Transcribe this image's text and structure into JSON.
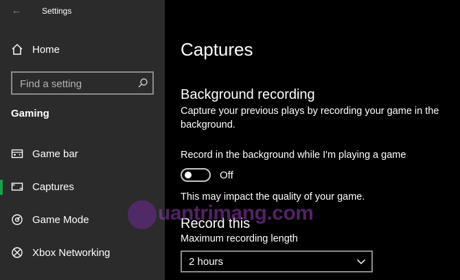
{
  "window": {
    "title": "Settings"
  },
  "sidebar": {
    "home_label": "Home",
    "search_placeholder": "Find a setting",
    "group_heading": "Gaming",
    "items": [
      {
        "label": "Game bar",
        "icon": "game-bar-icon"
      },
      {
        "label": "Captures",
        "icon": "captures-icon",
        "selected": true
      },
      {
        "label": "Game Mode",
        "icon": "game-mode-icon"
      },
      {
        "label": "Xbox Networking",
        "icon": "xbox-icon"
      }
    ]
  },
  "main": {
    "page_title": "Captures",
    "background_recording": {
      "title": "Background recording",
      "description": "Capture your previous plays by recording your game in the background.",
      "toggle_label": "Record in the background while I'm playing a game",
      "toggle_state": "Off",
      "note": "This may impact the quality of your game."
    },
    "record_this": {
      "title": "Record this",
      "max_length_label": "Maximum recording length",
      "max_length_value": "2 hours"
    }
  },
  "watermark": {
    "text": "uantrimang.com"
  },
  "colors": {
    "accent": "#17a34a",
    "sidebar_bg": "#2b2b2b",
    "main_bg": "#000000",
    "watermark": "#8b3aa8"
  }
}
